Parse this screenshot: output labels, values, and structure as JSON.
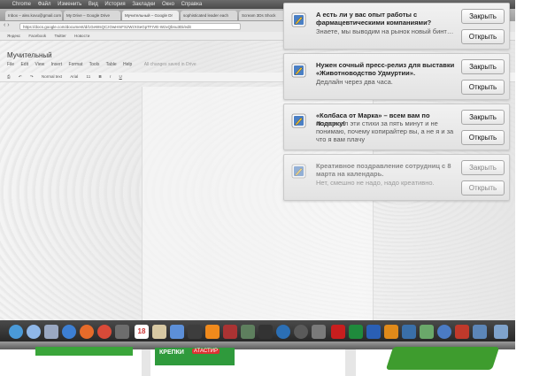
{
  "menubar": {
    "items": [
      "Chrome",
      "Файл",
      "Изменить",
      "Вид",
      "История",
      "Закладки",
      "Окно",
      "Справка"
    ]
  },
  "browser": {
    "tabs": [
      "Inbox – alex.kovu@gmail.com",
      "My Drive – Google Drive",
      "Мучительный – Google Dr",
      "sophisticated leader each",
      "Scream 3Ds Shock"
    ],
    "url": "https://docs.google.com/document/d/1GeWsQCzOwHmFSzWzXSeGpTFrVE-WzxQbnu3Di/edit",
    "bookmarks": [
      "Яндекс",
      "Facebook",
      "Twitter",
      "Новости"
    ]
  },
  "doc": {
    "title": "Мучительный",
    "menu": [
      "File",
      "Edit",
      "View",
      "Insert",
      "Format",
      "Tools",
      "Table",
      "Help"
    ],
    "saved_status": "All changes saved in Drive",
    "toolbar": [
      "Normal text",
      "Arial",
      "11"
    ]
  },
  "notifications": [
    {
      "title": "А есть ли у вас опыт работы с фармацевтическими компаниями?",
      "body": "Знаете, мы выводим на рынок новый бинт…",
      "close_label": "Закрыть",
      "open_label": "Открыть",
      "icon": "pencil-app-icon"
    },
    {
      "title": "Нужен сочный пресс-релиз для выставки «Животноводство Удмуртии».",
      "body": "Дедлайн через два часа.",
      "close_label": "Закрыть",
      "open_label": "Открыть",
      "icon": "pencil-app-icon"
    },
    {
      "title": "«Колбаса от Марка» – всем вам по подарку!",
      "body": "Я написал эти стихи за пять минут и не понимаю, почему копирайтер вы, а не я и за что я вам плачу",
      "close_label": "Закрыть",
      "open_label": "Открыть",
      "icon": "pencil-app-icon"
    },
    {
      "title": "Креативное поздравление сотрудниц с 8 марта на календарь.",
      "body": "Нет, смешно не надо, надо креативно.",
      "close_label": "Закрыть",
      "open_label": "Открыть",
      "icon": "pencil-app-icon"
    }
  ],
  "dock": {
    "calendar_day": "18"
  },
  "physical": {
    "box_label": "КРЕПКИ",
    "box_badge": "АТАСТИР"
  }
}
